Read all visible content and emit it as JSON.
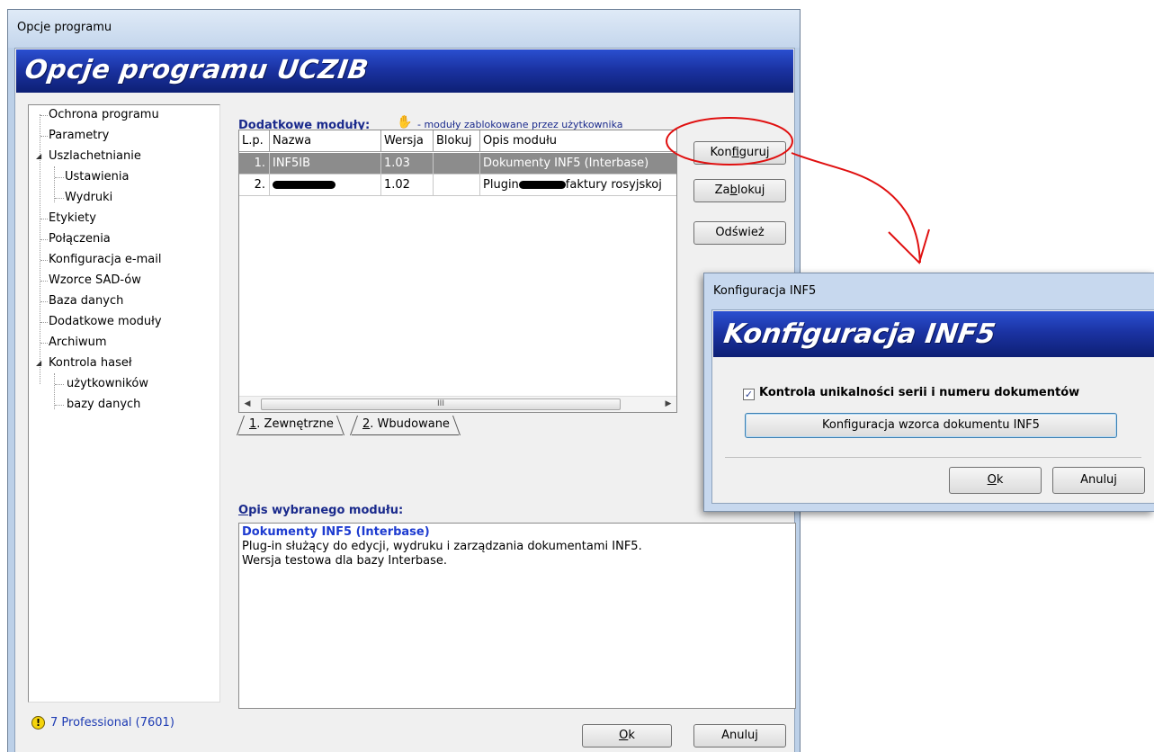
{
  "window": {
    "title": "Opcje programu",
    "banner": "Opcje programu UCZIB"
  },
  "tree": {
    "items": [
      {
        "label": "Ochrona programu"
      },
      {
        "label": "Parametry"
      },
      {
        "label": "Uszlachetnianie"
      },
      {
        "label": "Ustawienia"
      },
      {
        "label": "Wydruki"
      },
      {
        "label": "Etykiety"
      },
      {
        "label": "Połączenia"
      },
      {
        "label": "Konfiguracja e-mail"
      },
      {
        "label": "Wzorce SAD-ów"
      },
      {
        "label": "Baza danych"
      },
      {
        "label": "Dodatkowe moduły"
      },
      {
        "label": "Archiwum"
      },
      {
        "label": "Kontrola haseł"
      },
      {
        "label": "użytkowników"
      },
      {
        "label": "bazy danych"
      }
    ]
  },
  "modules": {
    "section_label_prefix": "Dodatkowe ",
    "section_label_underlined": "m",
    "section_label_suffix": "oduły:",
    "legend_note": "- moduły zablokowane przez użytkownika",
    "columns": [
      "L.p.",
      "Nazwa",
      "Wersja",
      "Blokuj",
      "Opis modułu"
    ],
    "rows": [
      {
        "lp": "1.",
        "name": "INF5IB",
        "version": "1.03",
        "blocked": "",
        "description": "Dokumenty INF5 (Interbase)"
      },
      {
        "lp": "2.",
        "name": "",
        "version": "1.02",
        "blocked": "",
        "description_prefix": "Plugin",
        "description_suffix": "faktury rosyjskoj"
      }
    ],
    "scrollbar_grip": "III"
  },
  "tabs": [
    {
      "hotkey": "1",
      "label": ". Zewnętrzne"
    },
    {
      "hotkey": "2",
      "label": ". Wbudowane"
    }
  ],
  "buttons": {
    "configure_prefix": "Kon",
    "configure_hotkey": "f",
    "configure_suffix": "iguruj",
    "block_prefix": "Za",
    "block_hotkey": "b",
    "block_suffix": "lokuj",
    "refresh": "Odśwież",
    "ok_hotkey": "O",
    "ok_suffix": "k",
    "cancel": "Anuluj"
  },
  "description": {
    "label_hotkey": "O",
    "label_suffix": "pis wybranego modułu:",
    "title": "Dokumenty INF5 (Interbase)",
    "line1": "Plug-in służący do edycji, wydruku i zarządzania dokumentami INF5.",
    "line2": "Wersja testowa dla bazy Interbase."
  },
  "status": {
    "text": "7 Professional (7601)"
  },
  "dialog": {
    "title": "Konfiguracja INF5",
    "banner": "Konfiguracja INF5",
    "checkbox_label": "Kontrola unikalności serii i numeru dokumentów",
    "checkbox_checked": true,
    "template_button": "Konfiguracja wzorca dokumentu INF5",
    "ok_hotkey": "O",
    "ok_suffix": "k",
    "cancel": "Anuluj"
  },
  "colors": {
    "banner": "#1b33a3",
    "selected_row": "#8c8c8c",
    "section_label": "#1a2a8c",
    "annotation": "#e01010"
  }
}
